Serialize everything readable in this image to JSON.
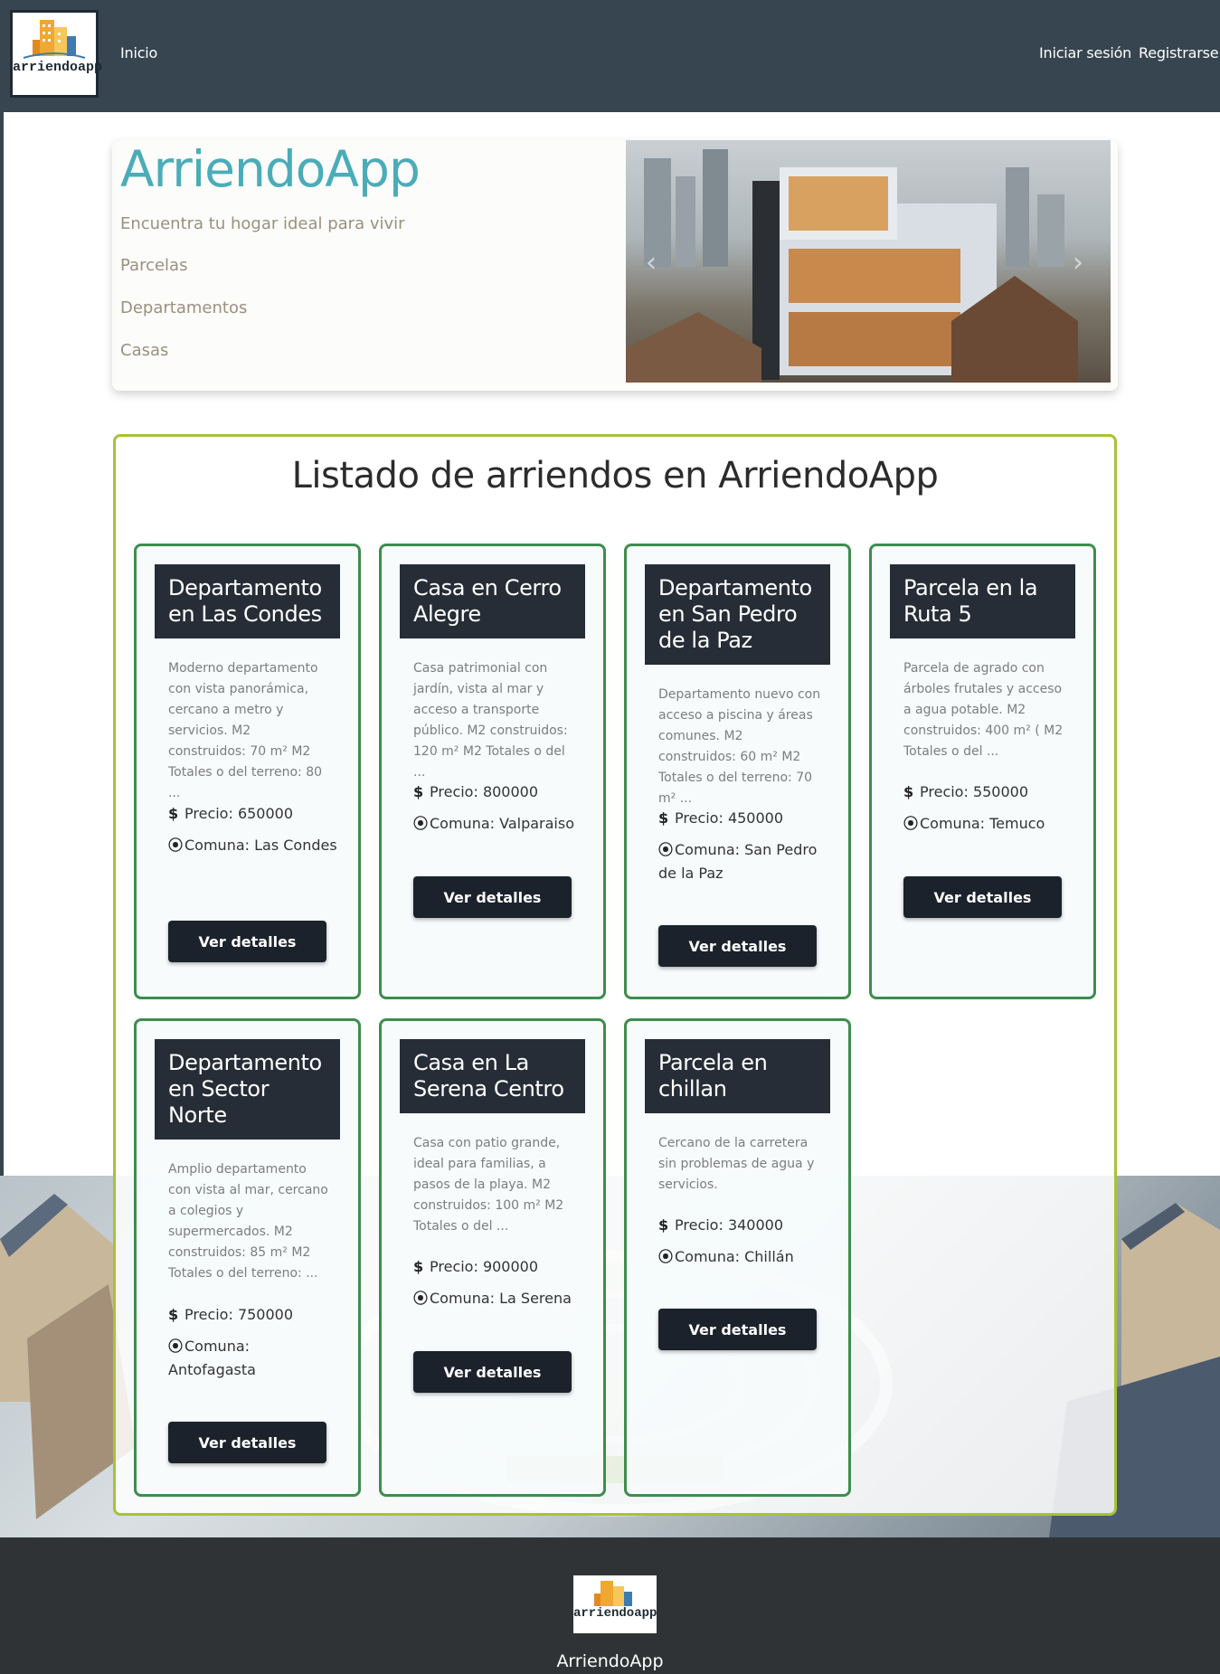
{
  "brand": {
    "logo_text": "arriendoapp",
    "name": "ArriendoApp"
  },
  "nav": {
    "home": "Inicio",
    "login": "Iniciar sesión",
    "register": "Registrarse"
  },
  "hero": {
    "title": "ArriendoApp",
    "subtitle": "Encuentra tu hogar ideal para vivir",
    "links": [
      "Parcelas",
      "Departamentos",
      "Casas"
    ],
    "carousel_prev_icon": "chevron-left-icon",
    "carousel_next_icon": "chevron-right-icon"
  },
  "listing": {
    "title": "Listado de arriendos en ArriendoApp",
    "button_label": "Ver detalles",
    "price_icon": "dollar-icon",
    "location_icon": "map-pin-icon",
    "cards": [
      {
        "title": "Departamento en Las Condes",
        "description": "Moderno departamento con vista panorámica, cercano a metro y servicios. M2 construidos: 70 m² M2 Totales o del terreno: 80 ...",
        "price": "Precio: 650000",
        "commune": "Comuna: Las Condes"
      },
      {
        "title": "Casa en Cerro Alegre",
        "description": "Casa patrimonial con jardín, vista al mar y acceso a transporte público. M2 construidos: 120 m² M2 Totales o del ...",
        "price": "Precio: 800000",
        "commune": "Comuna: Valparaiso"
      },
      {
        "title": "Departamento en San Pedro de la Paz",
        "description": "Departamento nuevo con acceso a piscina y áreas comunes. M2 construidos: 60 m² M2 Totales o del terreno: 70 m² ...",
        "price": "Precio: 450000",
        "commune": "Comuna: San Pedro de la Paz"
      },
      {
        "title": "Parcela en la Ruta 5",
        "description": "Parcela de agrado con árboles frutales y acceso a agua potable. M2 construidos: 400 m² ( M2 Totales o del ...",
        "price": "Precio: 550000",
        "commune": "Comuna: Temuco"
      },
      {
        "title": "Departamento en Sector Norte",
        "description": "Amplio departamento con vista al mar, cercano a colegios y supermercados. M2 construidos: 85 m² M2 Totales o del terreno: ...",
        "price": "Precio: 750000",
        "commune": "Comuna: Antofagasta"
      },
      {
        "title": "Casa en La Serena Centro",
        "description": "Casa con patio grande, ideal para familias, a pasos de la playa. M2 construidos: 100 m² M2 Totales o del ...",
        "price": "Precio: 900000",
        "commune": "Comuna: La Serena"
      },
      {
        "title": "Parcela en chillan",
        "description": "Cercano de la carretera sin problemas de agua y servicios.",
        "price": "Precio: 340000",
        "commune": "Comuna: Chillán"
      }
    ]
  },
  "colors": {
    "navbar": "#36454f",
    "hero_title": "#4bacb9",
    "listing_border": "#a8c23a",
    "card_border": "#3e8d4e",
    "card_header": "#262d36",
    "button": "#1c222b",
    "footer": "#2f3335"
  }
}
